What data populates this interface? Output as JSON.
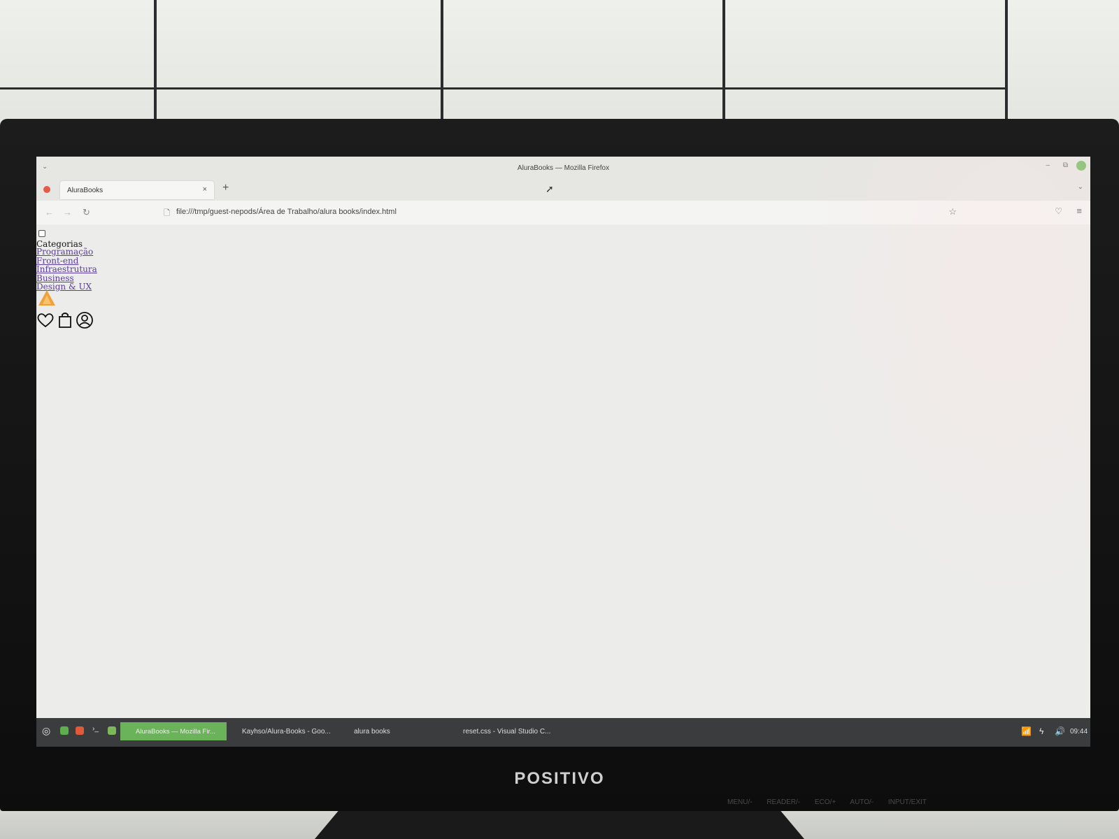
{
  "window": {
    "title": "AluraBooks — Mozilla Firefox",
    "tab_label": "AluraBooks",
    "tab_close": "×",
    "new_tab": "+",
    "url": "file:///tmp/guest-nepods/Área de Trabalho/alura books/index.html"
  },
  "page": {
    "categories_label": "Categorias",
    "categories": [
      "Programação",
      "Front-end",
      "Infraestrutura",
      "Business",
      "Design & UX"
    ],
    "header_icons": [
      "heart-icon",
      "shopping-bag-icon",
      "user-circle-icon"
    ]
  },
  "taskbar": {
    "items": [
      "AluraBooks — Mozilla Fir...",
      "Kayhso/Alura-Books - Goo...",
      "alura books",
      "reset.css - Visual Studio C..."
    ],
    "clock": "09:44"
  },
  "monitor": {
    "brand": "POSITIVO",
    "osd": "MENU/- READER/- ECO/+ AUTO/- INPUT/EXIT"
  },
  "colors": {
    "taskbar_active": "#6bb35a",
    "link": "#5a3d9a",
    "logo": "#f2a03a"
  }
}
